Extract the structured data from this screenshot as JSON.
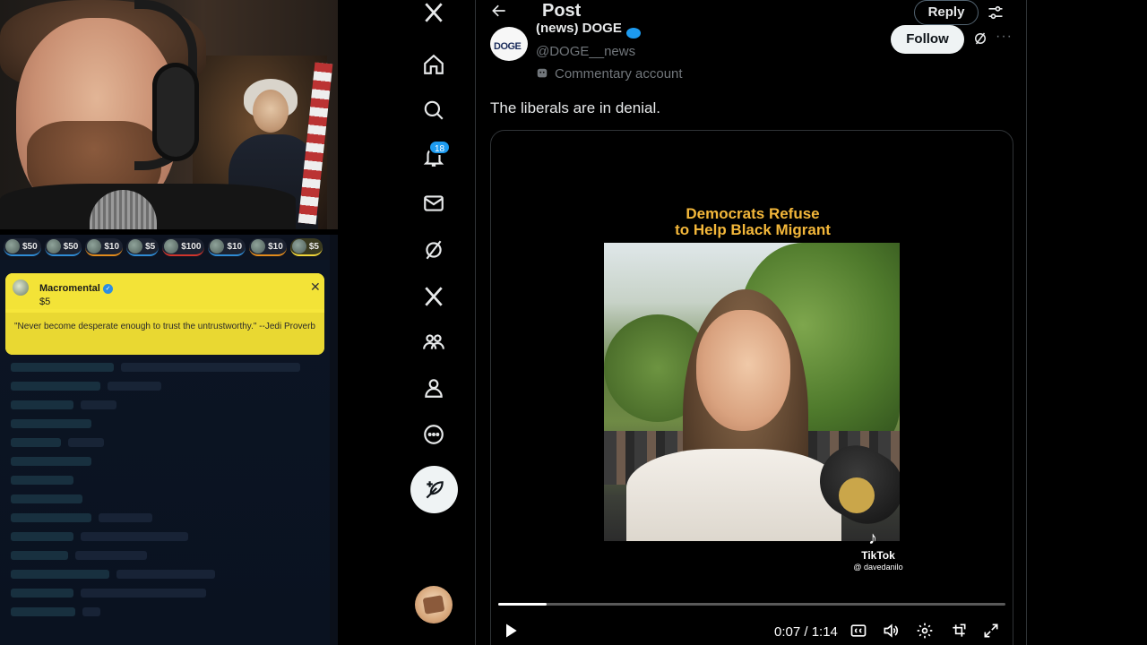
{
  "stream": {
    "donations": [
      {
        "amount": "$50",
        "style": "normal"
      },
      {
        "amount": "$50",
        "style": "normal"
      },
      {
        "amount": "$10",
        "style": "orange"
      },
      {
        "amount": "$5",
        "style": "normal"
      },
      {
        "amount": "$100",
        "style": "red"
      },
      {
        "amount": "$10",
        "style": "normal"
      },
      {
        "amount": "$10",
        "style": "orange"
      },
      {
        "amount": "$5",
        "style": "gold"
      }
    ],
    "highlight": {
      "name": "Macromental",
      "amount": "$5",
      "message": "\"Never become desperate enough to trust the untrustworthy.\" --Jedi Proverb",
      "close_glyph": "✕",
      "accent": "#f6e63a"
    }
  },
  "nav": {
    "notification_count": "18",
    "icons": [
      "x-logo-icon",
      "home-icon",
      "search-icon",
      "bell-icon",
      "mail-icon",
      "grok-icon",
      "x-premium-icon",
      "communities-icon",
      "profile-icon",
      "more-circle-icon"
    ]
  },
  "post": {
    "header_title": "Post",
    "reply_label": "Reply",
    "author_name": "(news) DOGE",
    "author_handle": "@DOGE__news",
    "avatar_text": "DOGE",
    "commentary_label": "Commentary account",
    "follow_label": "Follow",
    "more_glyph": "···",
    "text": "The liberals are in denial."
  },
  "video": {
    "caption_line1": "Democrats Refuse",
    "caption_line2": "to Help Black Migrant",
    "caption_color": "#f3b73a",
    "tiktok_glyph": "♪",
    "tiktok_label": "TikTok",
    "tiktok_handle": "@ davedanilo",
    "progress_percent": 9.5,
    "time": "0:07 / 1:14"
  },
  "colors": {
    "accent_blue": "#1d9bf0",
    "background": "#000000",
    "text_primary": "#e7e9ea",
    "text_secondary": "#71767b"
  }
}
